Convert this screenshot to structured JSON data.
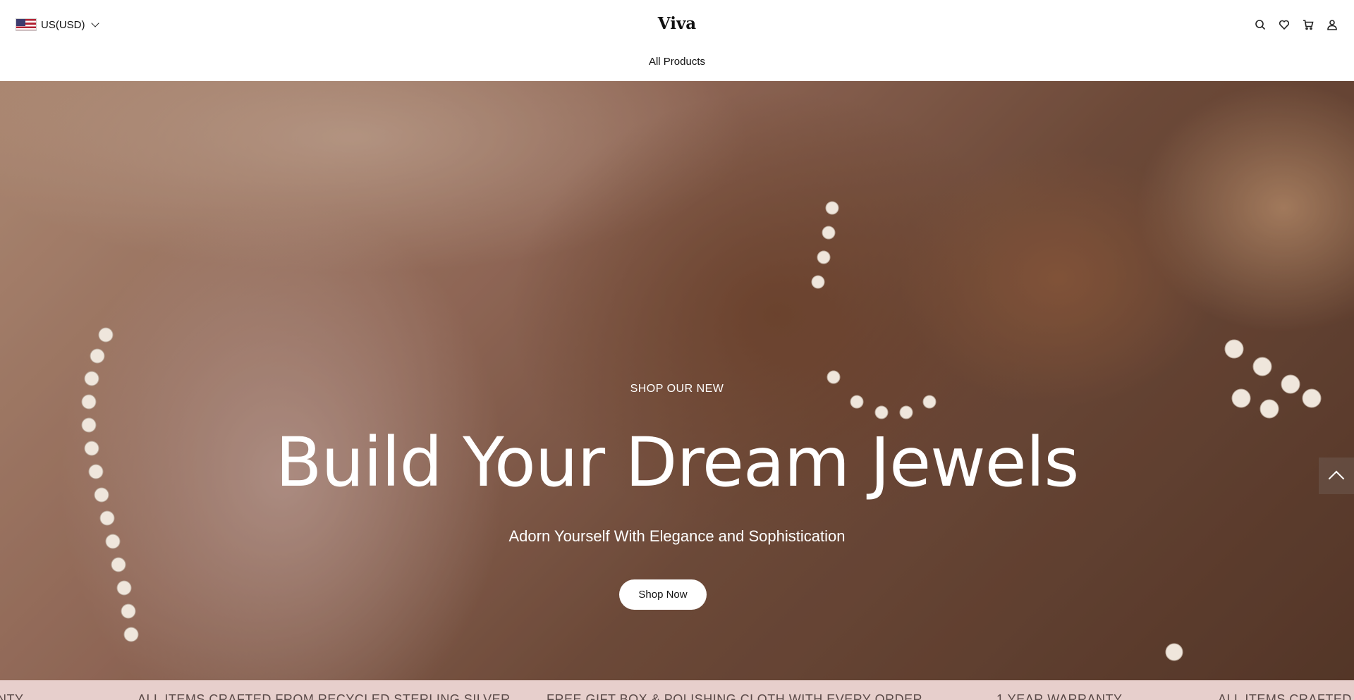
{
  "header": {
    "currency": "US(USD)",
    "brand": "Viva",
    "icons": [
      "search-icon",
      "heart-icon",
      "cart-icon",
      "user-icon"
    ]
  },
  "nav": {
    "items": [
      "All Products"
    ]
  },
  "hero": {
    "eyebrow": "SHOP OUR NEW",
    "headline": "Build Your Dream Jewels",
    "subline": "Adorn Yourself With Elegance and Sophistication",
    "cta": "Shop Now"
  },
  "marquee": {
    "items": [
      "NTY",
      "ALL ITEMS CRAFTED FROM RECYCLED STERLING SILVER",
      "FREE GIFT BOX & POLISHING CLOTH WITH EVERY ORDER",
      "1 YEAR WARRANTY",
      "ALL ITEMS CRAFTED F"
    ]
  },
  "colors": {
    "marquee_bg": "#e7cfcc",
    "button_bg": "#ffffff",
    "text_light": "#ffffff"
  }
}
